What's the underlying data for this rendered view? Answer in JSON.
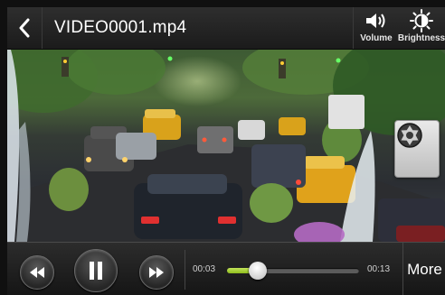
{
  "header": {
    "title": "VIDEO0001.mp4",
    "back_icon": "chevron-left-icon",
    "actions": [
      {
        "label": "Volume",
        "icon": "speaker-icon"
      },
      {
        "label": "Brightness",
        "icon": "sun-icon"
      }
    ]
  },
  "video": {
    "scene": "city-street-traffic",
    "overlay_button_icon": "camera-shutter-icon"
  },
  "controls": {
    "rewind_icon": "rewind-icon",
    "pause_icon": "pause-icon",
    "forward_icon": "fast-forward-icon",
    "current_time": "00:03",
    "total_time": "00:13",
    "progress": 0.23,
    "more_label": "More"
  },
  "colors": {
    "accent": "#9ccc2a",
    "bar_background": "#1b1b1b"
  }
}
